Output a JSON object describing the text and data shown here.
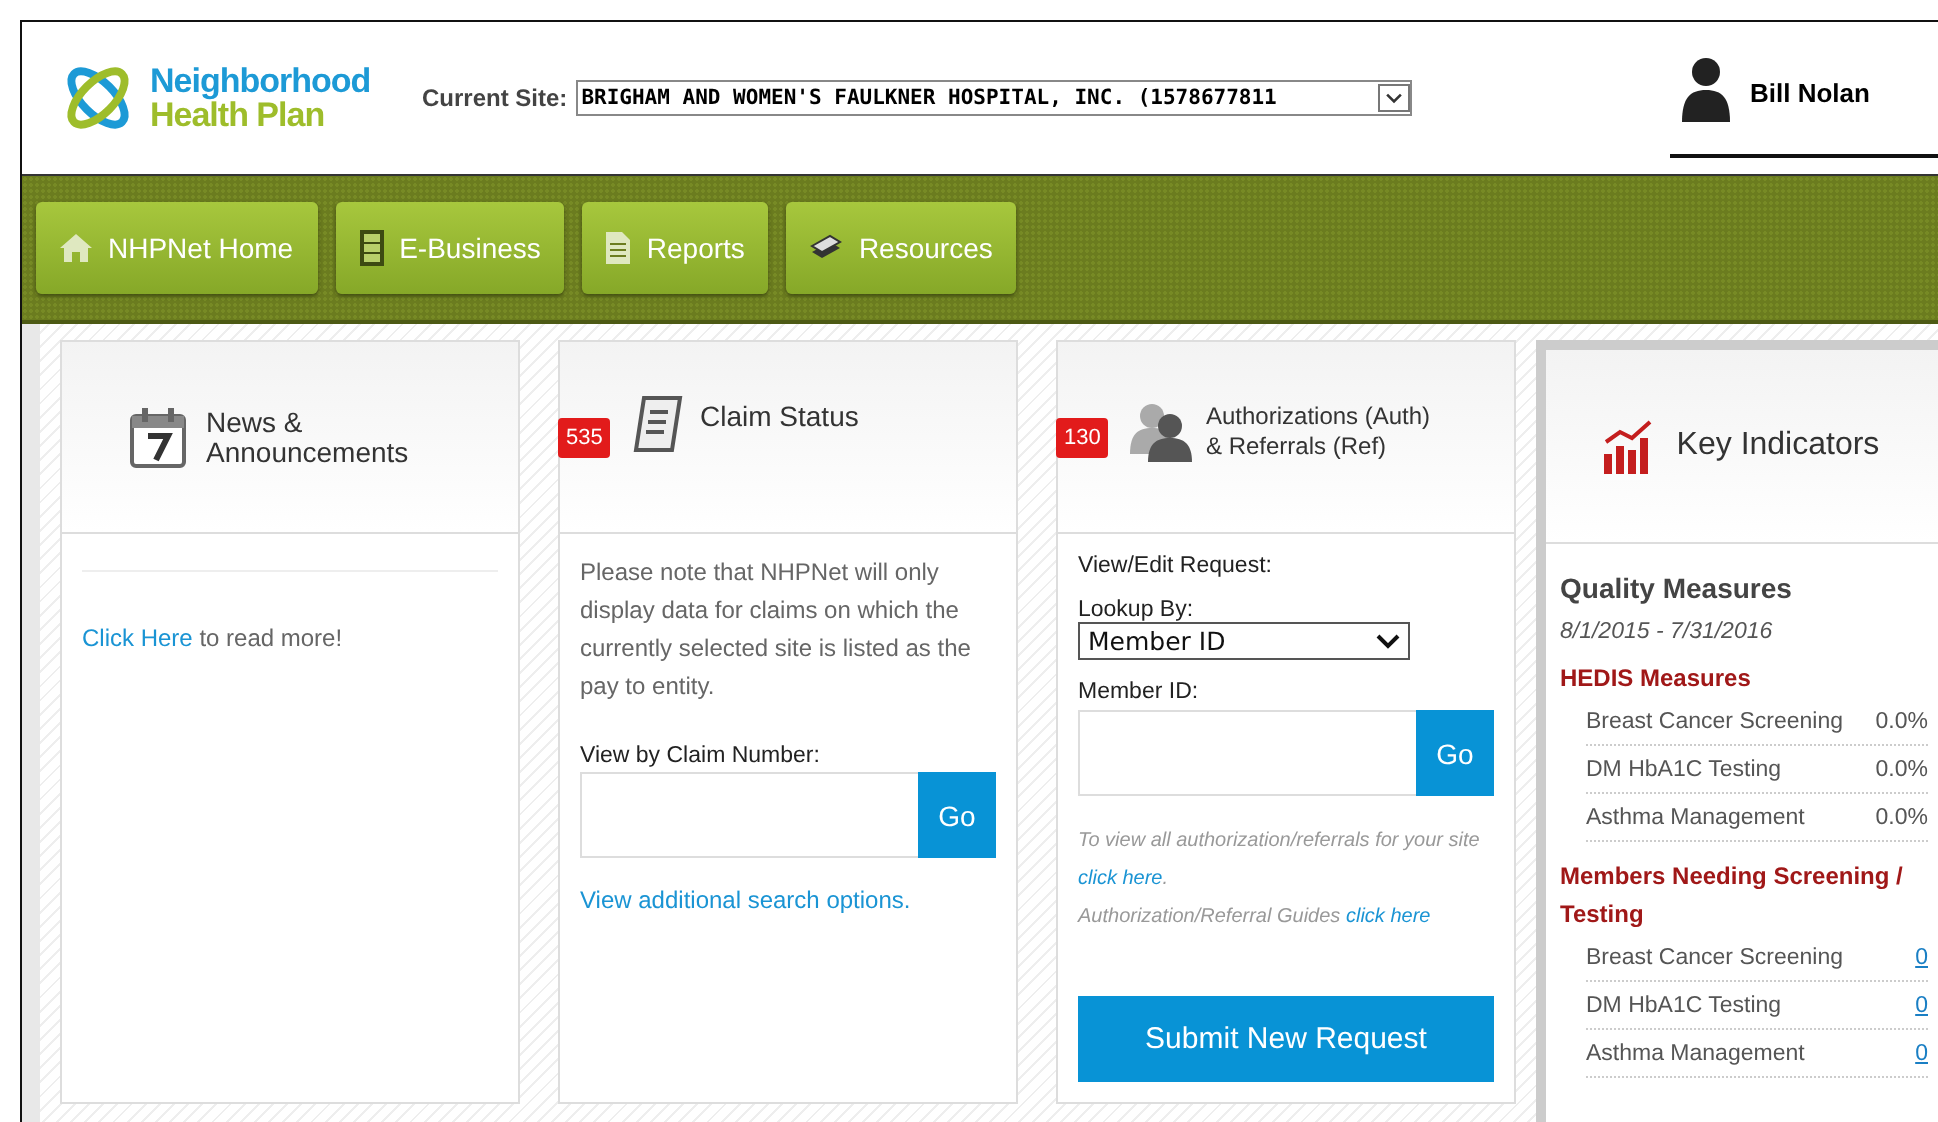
{
  "logo": {
    "line1": "Neighborhood",
    "line2": "Health Plan"
  },
  "site": {
    "label": "Current Site:",
    "value": "BRIGHAM AND WOMEN'S FAULKNER HOSPITAL, INC. (1578677811"
  },
  "user": {
    "name": "Bill Nolan"
  },
  "nav": [
    {
      "label": "NHPNet Home"
    },
    {
      "label": "E-Business"
    },
    {
      "label": "Reports"
    },
    {
      "label": "Resources"
    }
  ],
  "news": {
    "title": [
      "News &",
      "Announcements"
    ],
    "link": "Click Here",
    "text": "to read more!"
  },
  "claims": {
    "badge": "535",
    "title": "Claim Status",
    "note": "Please note that NHPNet will only display data for claims on which the currently selected site is listed as the pay to entity.",
    "field_label": "View by Claim Number:",
    "go": "Go",
    "link": "View additional search options."
  },
  "auth": {
    "badge": "130",
    "title": [
      "Authorizations (Auth)",
      "& Referrals (Ref)"
    ],
    "view_label": "View/Edit Request:",
    "lookup_label": "Lookup By:",
    "lookup_value": "Member ID",
    "member_label": "Member ID:",
    "go": "Go",
    "note1": "To view all authorization/referrals for your site",
    "note1_link": "click here",
    "note1_end": ".",
    "note2": "Authorization/Referral Guides",
    "note2_link": "click here",
    "submit": "Submit New Request"
  },
  "indicators": {
    "title": "Key Indicators",
    "section": "Quality Measures",
    "period": "8/1/2015 - 7/31/2016",
    "groups": [
      {
        "title": "HEDIS Measures",
        "kind": "percent",
        "rows": [
          {
            "name": "Breast Cancer Screening",
            "value": "0.0%"
          },
          {
            "name": "DM HbA1C Testing",
            "value": "0.0%"
          },
          {
            "name": "Asthma Management",
            "value": "0.0%"
          }
        ]
      },
      {
        "title": "Members Needing Screening / Testing",
        "kind": "link",
        "rows": [
          {
            "name": "Breast Cancer Screening",
            "value": "0"
          },
          {
            "name": "DM HbA1C Testing",
            "value": "0"
          },
          {
            "name": "Asthma Management",
            "value": "0"
          }
        ]
      }
    ]
  }
}
